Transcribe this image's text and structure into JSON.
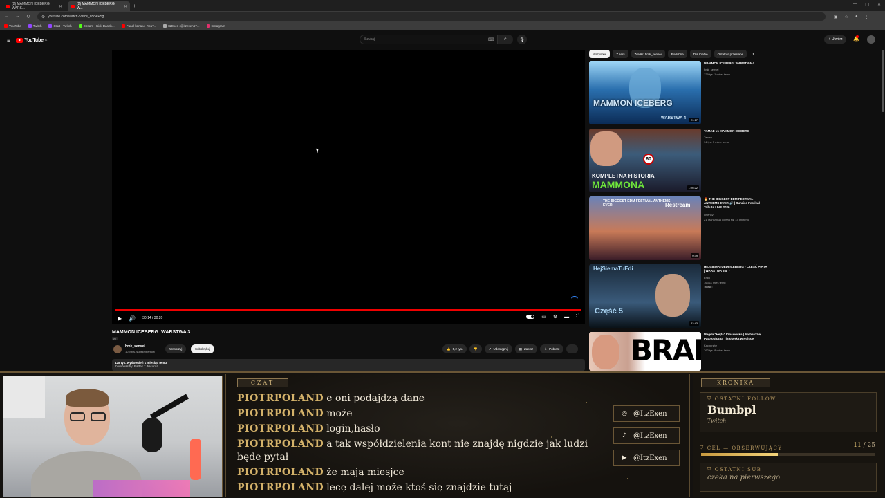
{
  "browser": {
    "tabs": [
      {
        "label": "(2) MAMMON ICEBERG: WARS..."
      },
      {
        "label": "(2) MAMMON ICEBERG: W..."
      }
    ],
    "address": "youtube.com/watch?v=tcs_o5qAP5g",
    "bookmarks": [
      "YouTube",
      "Twitch",
      "Start - Twitch",
      "Stream - Kick Dashb...",
      "Panel kanału - YouT...",
      "ItzExen (@itzexen67...",
      "Instagram"
    ]
  },
  "youtube": {
    "logo": "YouTube",
    "logo_region": "PL",
    "search_placeholder": "Szukaj",
    "create_label": "Utwórz"
  },
  "player": {
    "time": "30:14 / 30:20",
    "progress": 0.997
  },
  "video": {
    "title": "MAMMON ICEBERG: WARSTWA 3",
    "badge": "AI",
    "channel": "hmk_sensei",
    "subscribers": "10,9 tys. subskrybentów",
    "support_label": "Wesprzyj",
    "subscribe_label": "Subskrybuj",
    "likes": "5,2 tys.",
    "share_label": "Udostępnij",
    "save_label": "Zapisz",
    "download_label": "Pobierz",
    "views_line": "128 tys. wyświetleń  1 miesiąc temu",
    "desc_line": "thumbnail by: Bartek z discorda"
  },
  "chips": [
    "Wszystkie",
    "Z serii",
    "Źródło: hmk_sensei",
    "Podobne",
    "Dla Ciebie",
    "Ostatnio przesłane"
  ],
  "recommendations": [
    {
      "title": "MAMMON ICEBERG: WARSTWA 4",
      "channel": "hmk_sensei",
      "meta": "129 tys.  1 mies. temu",
      "duration": "29:17",
      "thumb_text": "MAMMON ICEBERG",
      "thumb_text2": "WARSTWA 4"
    },
    {
      "title": "TAMAE vs MAMMON ICEBERG",
      "channel": "Tamae",
      "meta": "94 tys.  3 mies. temu",
      "duration": "1:26:22",
      "thumb_text": "KOMPLETNA HISTORIA",
      "thumb_text2": "MAMMONA"
    },
    {
      "title": "🔥 THE BIGGEST EDM FESTIVAL ANTHEMS EVER 🔊 | Sunrise Festival Tribute LIVE 2026",
      "channel": "djsensy",
      "meta": "21  Transmisja odbyła się 13 dni temu",
      "duration": "0:39",
      "thumb_text": "THE BIGGEST EDM FESTIVAL ANTHEMS EVER",
      "thumb_text2": "Restream"
    },
    {
      "title": "HEJSIEMATUEDI ICEBERG - CZĘŚĆ PIĄTA | WARSTWA 6 & 7",
      "channel": "Erdik I",
      "meta": "163  11 mies temu",
      "duration": "42:43",
      "badge": "Nowy",
      "thumb_text": "HejSiemaTuEdi",
      "thumb_text2": "Część 5"
    },
    {
      "title": "Magda \"Hejta\" Kłosowska | Najbardziej Patologiczna Tiktokerka w Polsce",
      "channel": "Kacperzhe",
      "meta": "762 tys.  8 mies. temu",
      "duration": "",
      "thumb_text": "BRAK",
      "thumb_text2": ""
    }
  ],
  "overlay": {
    "chat_header": "CZAT",
    "chat": [
      {
        "user": "PIOTRPOLAND",
        "msg": "e oni podajdzą dane"
      },
      {
        "user": "PIOTRPOLAND",
        "msg": "może"
      },
      {
        "user": "PIOTRPOLAND",
        "msg": "login,hasło"
      },
      {
        "user": "PIOTRPOLAND",
        "msg": "a tak współdzielenia kont nie znajdę nigdzie jak ludzi będe pytał"
      },
      {
        "user": "PIOTRPOLAND",
        "msg": "że mają miesjce"
      },
      {
        "user": "PIOTRPOLAND",
        "msg": "lecę dalej może ktoś się znajdzie tutaj"
      }
    ],
    "socials": [
      {
        "icon": "instagram-icon",
        "handle": "@ItzExen"
      },
      {
        "icon": "tiktok-icon",
        "handle": "@ItzExen"
      },
      {
        "icon": "youtube-icon",
        "handle": "@ItzExen"
      }
    ],
    "chronicle_header": "KRONIKA",
    "last_follow_label": "OSTATNI FOLLOW",
    "last_follow_name": "Bumbpl",
    "last_follow_platform": "Twitch",
    "goal_label": "CEL — OBSERWUJĄCY",
    "goal_current": "11",
    "goal_total": "25",
    "goal_fraction": 0.44,
    "last_sub_label": "OSTATNI SUB",
    "last_sub_value": "czeka na pierwszego"
  }
}
